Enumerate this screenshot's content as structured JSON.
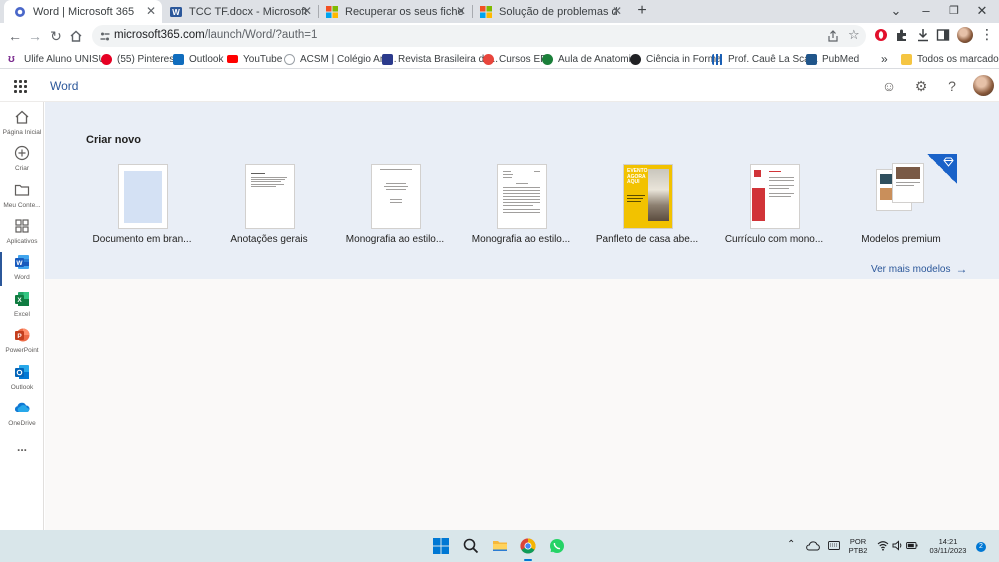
{
  "browser": {
    "tabs": [
      {
        "title": "Word | Microsoft 365",
        "active": true
      },
      {
        "title": "TCC TF.docx - Microsoft Word Online",
        "active": false
      },
      {
        "title": "Recuperar os seus ficheiros e dados",
        "active": false
      },
      {
        "title": "Solução de problemas da Administração",
        "active": false
      }
    ],
    "new_tab": "+",
    "url_host": "microsoft365.com",
    "url_path": "/launch/Word/?auth=1",
    "bookmarks": [
      {
        "label": "Ulife Aluno UNISUL",
        "color": "#7b2c8f"
      },
      {
        "label": "(55) Pinterest",
        "color": "#e60023"
      },
      {
        "label": "Outlook",
        "color": "#0f6cbd"
      },
      {
        "label": "YouTube",
        "color": "#ff0000"
      },
      {
        "label": "ACSM | Colégio Am...",
        "color": "#9aa0a6"
      },
      {
        "label": "Revista Brasileira de...",
        "color": "#2b3a8c"
      },
      {
        "label": "Cursos EF",
        "color": "#e8453c"
      },
      {
        "label": "Aula de Anatomia",
        "color": "#1b7f3a"
      },
      {
        "label": "Ciência in Forma",
        "color": "#202124"
      },
      {
        "label": "Prof. Cauê La Scala",
        "color": "#1a5fb4"
      },
      {
        "label": "PubMed",
        "color": "#20558a"
      }
    ],
    "bookmarks_overflow": "»",
    "all_bookmarks": "Todos os marcadores"
  },
  "app": {
    "title": "Word",
    "accent": "#2b579a"
  },
  "rail": [
    {
      "label": "Página Inicial",
      "icon": "home-icon"
    },
    {
      "label": "Criar",
      "icon": "plus-icon"
    },
    {
      "label": "Meu Conte...",
      "icon": "folder-icon"
    },
    {
      "label": "Aplicativos",
      "icon": "apps-icon"
    },
    {
      "label": "Word",
      "icon": "word-icon"
    },
    {
      "label": "Excel",
      "icon": "excel-icon"
    },
    {
      "label": "PowerPoint",
      "icon": "powerpoint-icon"
    },
    {
      "label": "Outlook",
      "icon": "outlook-icon"
    },
    {
      "label": "OneDrive",
      "icon": "onedrive-icon"
    },
    {
      "label": "...",
      "icon": "more-icon"
    }
  ],
  "main": {
    "section_title": "Criar novo",
    "templates": [
      {
        "label": "Documento em bran..."
      },
      {
        "label": "Anotações gerais"
      },
      {
        "label": "Monografia ao estilo..."
      },
      {
        "label": "Monografia ao estilo..."
      },
      {
        "label": "Panfleto de casa abe..."
      },
      {
        "label": "Currículo com mono..."
      },
      {
        "label": "Modelos premium"
      }
    ],
    "flyer_text": "EVENTO AGORA AQUI",
    "see_more": "Ver mais modelos",
    "see_more_arrow": "→"
  },
  "taskbar": {
    "lang_line1": "POR",
    "lang_line2": "PTB2",
    "time": "14:21",
    "date": "03/11/2023",
    "notifications": "2"
  }
}
